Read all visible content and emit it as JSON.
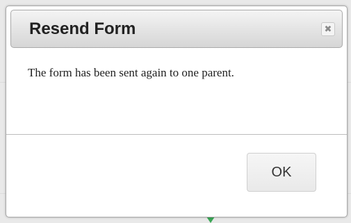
{
  "dialog": {
    "title": "Resend Form",
    "close_icon": "close-icon",
    "close_glyph": "✖",
    "message": "The form has been sent again to one parent.",
    "ok_label": "OK"
  },
  "colors": {
    "titlebar_gradient_top": "#f4f4f4",
    "titlebar_gradient_bottom": "#d6d6d6",
    "background_accent_arrow": "#3aa655"
  }
}
